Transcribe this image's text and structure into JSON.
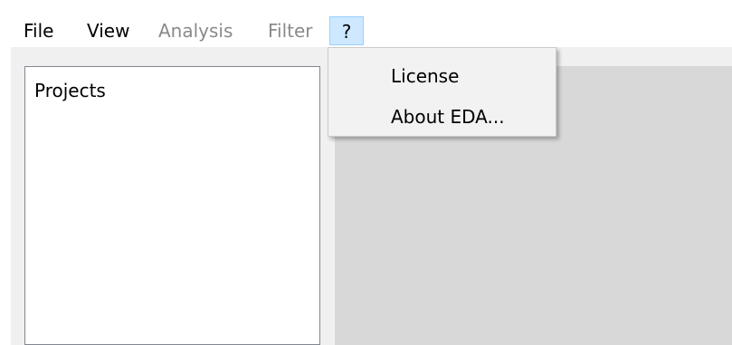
{
  "menubar": {
    "items": [
      {
        "label": "File",
        "enabled": true
      },
      {
        "label": "View",
        "enabled": true
      },
      {
        "label": "Analysis",
        "enabled": false
      },
      {
        "label": "Filter",
        "enabled": false
      },
      {
        "label": "?",
        "enabled": true,
        "open": true
      }
    ]
  },
  "left_panel": {
    "title": "Projects"
  },
  "help_menu": {
    "items": [
      {
        "label": "License"
      },
      {
        "label": "About EDA..."
      }
    ]
  },
  "colors": {
    "menu_active_bg": "#cde8ff",
    "menu_active_border": "#99d1ff",
    "disabled_text": "#8a8a8a",
    "workspace_bg": "#d8d8d8",
    "dropdown_bg": "#f2f2f2"
  }
}
